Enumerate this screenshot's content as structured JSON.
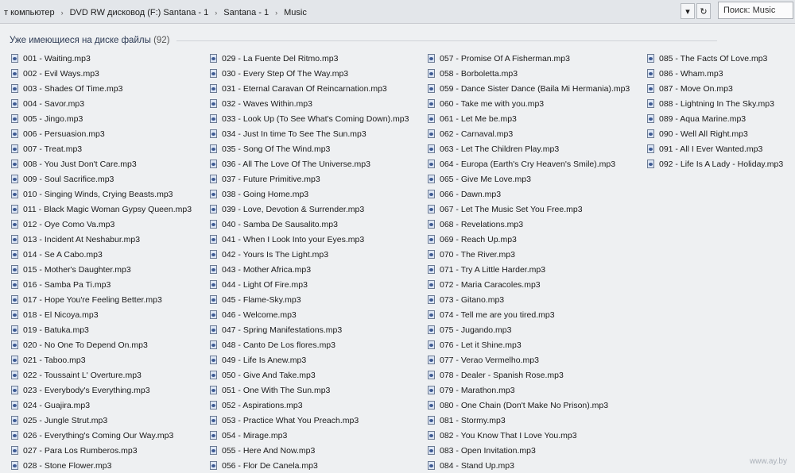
{
  "address_bar": {
    "segments": [
      "т компьютер",
      "DVD RW дисковод (F:) Santana - 1",
      "Santana - 1",
      "Music"
    ],
    "separator": "›"
  },
  "nav": {
    "dropdown_glyph": "▾",
    "refresh_glyph": "↻"
  },
  "search": {
    "placeholder": "Поиск: Music"
  },
  "group": {
    "title": "Уже имеющиеся на диске файлы",
    "count": "(92)"
  },
  "columns": [
    [
      "001 - Waiting.mp3",
      "002 - Evil Ways.mp3",
      "003 - Shades Of Time.mp3",
      "004 - Savor.mp3",
      "005 - Jingo.mp3",
      "006 - Persuasion.mp3",
      "007 - Treat.mp3",
      "008 - You Just Don't Care.mp3",
      "009 - Soul Sacrifice.mp3",
      "010 - Singing Winds, Crying Beasts.mp3",
      "011 - Black Magic Woman Gypsy Queen.mp3",
      "012 - Oye Como Va.mp3",
      "013 - Incident At Neshabur.mp3",
      "014 - Se A Cabo.mp3",
      "015 - Mother's Daughter.mp3",
      "016 - Samba Pa Ti.mp3",
      "017 - Hope You're Feeling Better.mp3",
      "018 - El Nicoya.mp3",
      "019 - Batuka.mp3",
      "020 - No One To Depend On.mp3",
      "021 - Taboo.mp3",
      "022 - Toussaint L' Overture.mp3",
      "023 - Everybody's Everything.mp3",
      "024 - Guajira.mp3",
      "025 - Jungle Strut.mp3",
      "026 - Everything's Coming Our Way.mp3",
      "027 - Para Los Rumberos.mp3",
      "028 - Stone Flower.mp3"
    ],
    [
      "029 - La Fuente Del Ritmo.mp3",
      "030 - Every Step Of The Way.mp3",
      "031 - Eternal Caravan Of Reincarnation.mp3",
      "032 - Waves Within.mp3",
      "033 - Look Up (To See What's Coming Down).mp3",
      "034 - Just In time To See The Sun.mp3",
      "035 - Song Of The Wind.mp3",
      "036 - All The Love Of The Universe.mp3",
      "037 - Future Primitive.mp3",
      "038 - Going Home.mp3",
      "039 - Love, Devotion & Surrender.mp3",
      "040 - Samba De Sausalito.mp3",
      "041 - When I Look Into your Eyes.mp3",
      "042 - Yours Is The Light.mp3",
      "043 - Mother Africa.mp3",
      "044 - Light Of Fire.mp3",
      "045 - Flame-Sky.mp3",
      "046 - Welcome.mp3",
      "047 - Spring Manifestations.mp3",
      "048 - Canto De Los flores.mp3",
      "049 - Life Is Anew.mp3",
      "050 - Give And Take.mp3",
      "051 - One With The Sun.mp3",
      "052 - Aspirations.mp3",
      "053 - Practice What You Preach.mp3",
      "054 - Mirage.mp3",
      "055 - Here And Now.mp3",
      "056 - Flor De Canela.mp3"
    ],
    [
      "057 - Promise Of A Fisherman.mp3",
      "058 - Borboletta.mp3",
      "059 - Dance Sister Dance (Baila Mi Hermania).mp3",
      "060 - Take me with you.mp3",
      "061 - Let Me be.mp3",
      "062 - Carnaval.mp3",
      "063 - Let The Children Play.mp3",
      "064 - Europa (Earth's Cry Heaven's Smile).mp3",
      "065 - Give Me Love.mp3",
      "066 - Dawn.mp3",
      "067 - Let The Music Set You Free.mp3",
      "068 - Revelations.mp3",
      "069 - Reach Up.mp3",
      "070 - The River.mp3",
      "071 - Try A Little Harder.mp3",
      "072 - Maria Caracoles.mp3",
      "073 - Gitano.mp3",
      "074 - Tell me are you tired.mp3",
      "075 - Jugando.mp3",
      "076 - Let it Shine.mp3",
      "077 - Verao Vermelho.mp3",
      "078 - Dealer - Spanish Rose.mp3",
      "079 - Marathon.mp3",
      "080 - One Chain (Don't Make No Prison).mp3",
      "081 - Stormy.mp3",
      "082 - You Know That I Love You.mp3",
      "083 - Open Invitation.mp3",
      "084 - Stand Up.mp3"
    ],
    [
      "085 - The Facts Of Love.mp3",
      "086 - Wham.mp3",
      "087 - Move On.mp3",
      "088 - Lightning In The Sky.mp3",
      "089 - Aqua Marine.mp3",
      "090 - Well All Right.mp3",
      "091 - All I Ever Wanted.mp3",
      "092 - Life Is A Lady - Holiday.mp3"
    ]
  ],
  "watermark": "www.ay.by"
}
